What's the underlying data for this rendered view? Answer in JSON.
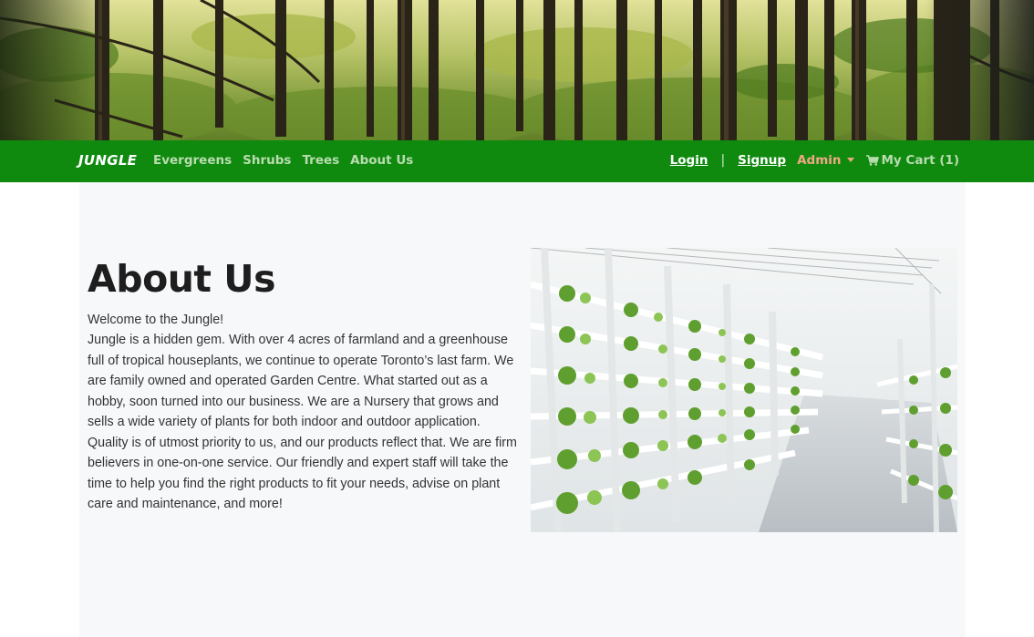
{
  "navbar": {
    "brand": "JUNGLE",
    "links": [
      "Evergreens",
      "Shrubs",
      "Trees",
      "About Us"
    ],
    "login": "Login",
    "separator": "|",
    "signup": "Signup",
    "admin": "Admin",
    "cart": "My Cart (1)"
  },
  "about": {
    "title": "About Us",
    "welcome": "Welcome to the Jungle!",
    "body": "Jungle is a hidden gem. With over 4 acres of farmland and a greenhouse full of tropical houseplants, we continue to operate Toronto’s last farm. We are family owned and operated Garden Centre. What started out as a hobby, soon turned into our business. We are a Nursery that grows and sells a wide variety of plants for both indoor and outdoor application. Quality is of utmost priority to us, and our products reflect that. We are firm believers in one-on-one service. Our friendly and expert staff will take the time to help you find the right products to fit your needs, advise on plant care and maintenance, and more!"
  },
  "icons": {
    "cart": "shopping-cart-icon",
    "admin_dropdown": "caret-down-icon"
  },
  "colors": {
    "navbar": "#0f8a0f",
    "nav_link": "#b9dcb0",
    "admin": "#f0a882",
    "container_bg": "#f7f8fa"
  }
}
